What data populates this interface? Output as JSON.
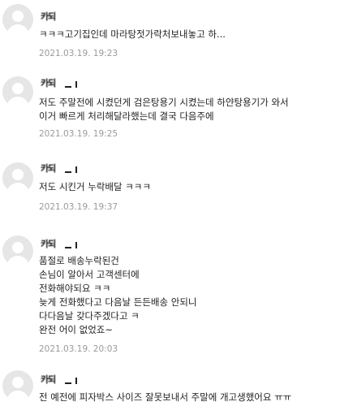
{
  "comments": [
    {
      "nickname": "카되",
      "lines": [
        "ㅋㅋㅋ고기집인데 마라탕젓가락처보내놓고 하..."
      ],
      "date": "2021.03.19. 19:23"
    },
    {
      "nickname": "카되",
      "lines": [
        "저도 주말전에 시켰던게 검은탕용기 시켰는데 하얀탕용기가 와서",
        "이거 빠르게 처리해달라했는데 결국 다음주에"
      ],
      "date": "2021.03.19. 19:25"
    },
    {
      "nickname": "카되",
      "lines": [
        "저도 시킨거 누락배달 ㅋㅋㅋ"
      ],
      "date": "2021.03.19. 19:37"
    },
    {
      "nickname": "카되",
      "lines": [
        "품절로 배송누락된건",
        "손님이 알아서 고객센터에",
        "전화해야되요 ㅋㅋ",
        "늦게 전화했다고 다음날 든든배송 안되니",
        "다다음날 갖다주겠다고 ㅋ",
        "완전 어이 없었죠~"
      ],
      "date": "2021.03.19. 20:03"
    },
    {
      "nickname": "카되",
      "lines": [
        "전 예전에 피자박스 사이즈 잘못보내서 주말에 개고생했어요 ㅠㅠ"
      ],
      "date": ""
    }
  ]
}
